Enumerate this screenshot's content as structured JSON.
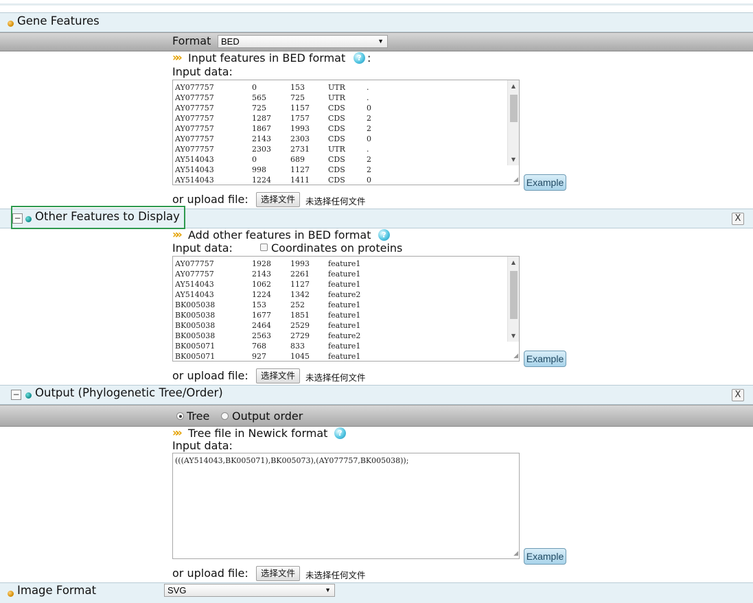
{
  "gene_features": {
    "title": "Gene Features",
    "format_label": "Format",
    "format_value": "BED",
    "input_heading": "Input features in BED format",
    "input_heading_colon": ":",
    "input_data_label": "Input data:",
    "rows": [
      [
        "AY077757",
        "0",
        "153",
        "UTR",
        "."
      ],
      [
        "AY077757",
        "565",
        "725",
        "UTR",
        "."
      ],
      [
        "AY077757",
        "725",
        "1157",
        "CDS",
        "0"
      ],
      [
        "AY077757",
        "1287",
        "1757",
        "CDS",
        "2"
      ],
      [
        "AY077757",
        "1867",
        "1993",
        "CDS",
        "2"
      ],
      [
        "AY077757",
        "2143",
        "2303",
        "CDS",
        "0"
      ],
      [
        "AY077757",
        "2303",
        "2731",
        "UTR",
        "."
      ],
      [
        "AY514043",
        "0",
        "689",
        "CDS",
        "2"
      ],
      [
        "AY514043",
        "998",
        "1127",
        "CDS",
        "2"
      ],
      [
        "AY514043",
        "1224",
        "1411",
        "CDS",
        "0"
      ]
    ],
    "example_label": "Example",
    "upload_label": "or upload file:",
    "choose_file": "选择文件",
    "no_file": "未选择任何文件"
  },
  "other_features": {
    "toggle": "−",
    "title": "Other Features to Display",
    "close": "X",
    "input_heading": "Add other features in BED format",
    "input_data_label": "Input data:",
    "coords_label": "Coordinates on proteins",
    "coords_checked": false,
    "rows": [
      [
        "AY077757",
        "1928",
        "1993",
        "feature1"
      ],
      [
        "AY077757",
        "2143",
        "2261",
        "feature1"
      ],
      [
        "AY514043",
        "1062",
        "1127",
        "feature1"
      ],
      [
        "AY514043",
        "1224",
        "1342",
        "feature2"
      ],
      [
        "BK005038",
        "153",
        "252",
        "feature1"
      ],
      [
        "BK005038",
        "1677",
        "1851",
        "feature1"
      ],
      [
        "BK005038",
        "2464",
        "2529",
        "feature1"
      ],
      [
        "BK005038",
        "2563",
        "2729",
        "feature2"
      ],
      [
        "BK005071",
        "768",
        "833",
        "feature1"
      ],
      [
        "BK005071",
        "927",
        "1045",
        "feature1"
      ]
    ],
    "example_label": "Example",
    "upload_label": "or upload file:",
    "choose_file": "选择文件",
    "no_file": "未选择任何文件"
  },
  "output": {
    "toggle": "−",
    "title": "Output (Phylogenetic Tree/Order)",
    "close": "X",
    "option_tree": "Tree",
    "option_order": "Output order",
    "selected": "Tree",
    "input_heading": "Tree file in Newick format",
    "input_data_label": "Input data:",
    "newick": "(((AY514043,BK005071),BK005073),(AY077757,BK005038));",
    "example_label": "Example",
    "upload_label": "or upload file:",
    "choose_file": "选择文件",
    "no_file": "未选择任何文件"
  },
  "image_format": {
    "title": "Image Format",
    "value": "SVG"
  },
  "icons": {
    "help": "?",
    "arrow": "▼",
    "up": "▲",
    "down": "▼",
    "resize": "◢",
    "chevron": "»"
  },
  "colors": {
    "section_bg": "#e6f1f6",
    "highlight_border": "#2f9a4f",
    "example_button": "#a9d4ea",
    "chevron": "#e3a000"
  }
}
